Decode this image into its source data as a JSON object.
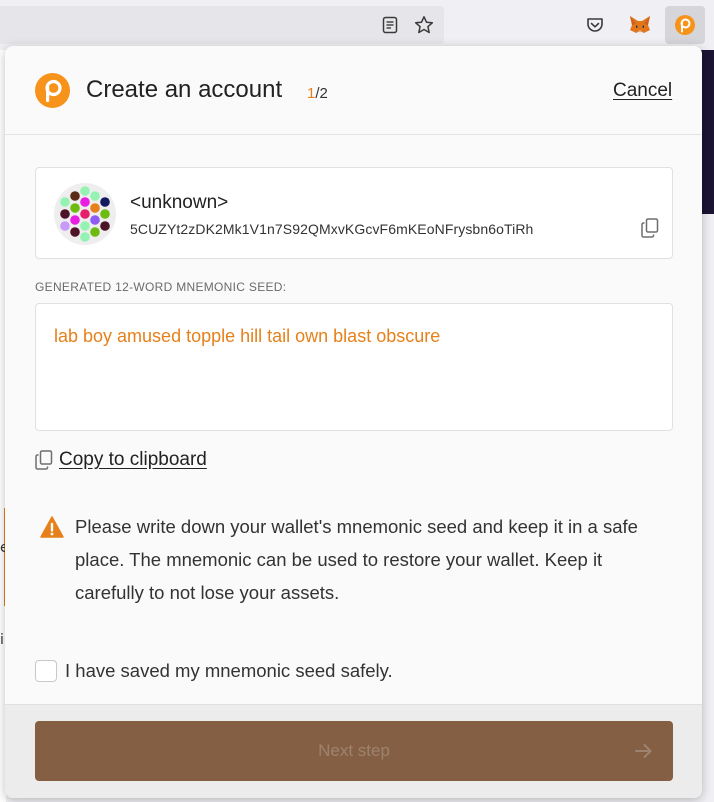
{
  "browser": {
    "icons": [
      "reader-view-icon",
      "bookmark-star-icon",
      "pocket-icon",
      "metamask-fox-icon",
      "polkadot-extension-icon"
    ]
  },
  "background": {
    "fragment_1": "e",
    "fragment_2": "i"
  },
  "popup": {
    "title": "Create an account",
    "step_current": "1",
    "step_total": "/2",
    "cancel_label": "Cancel",
    "account": {
      "name": "<unknown>",
      "address": "5CUZYt2zDK2Mk1V1n7S92QMxvKGcvF6mKEoNFrysbn6oTiRh"
    },
    "seed": {
      "label": "GENERATED 12-WORD MNEMONIC SEED:",
      "phrase": "lab boy amused topple hill tail own blast obscure"
    },
    "copy_label": "Copy to clipboard",
    "warning": "Please write down your wallet's mnemonic seed and keep it in a safe place. The mnemonic can be used to restore your wallet. Keep it carefully to not lose your assets.",
    "checkbox": {
      "label": "I have saved my mnemonic seed safely.",
      "checked": false
    },
    "next_button": {
      "label": "Next step",
      "enabled": false
    }
  },
  "colors": {
    "accent_orange": "#e6801a",
    "button_brown": "#855f43",
    "button_text_disabled": "#9c836f"
  }
}
